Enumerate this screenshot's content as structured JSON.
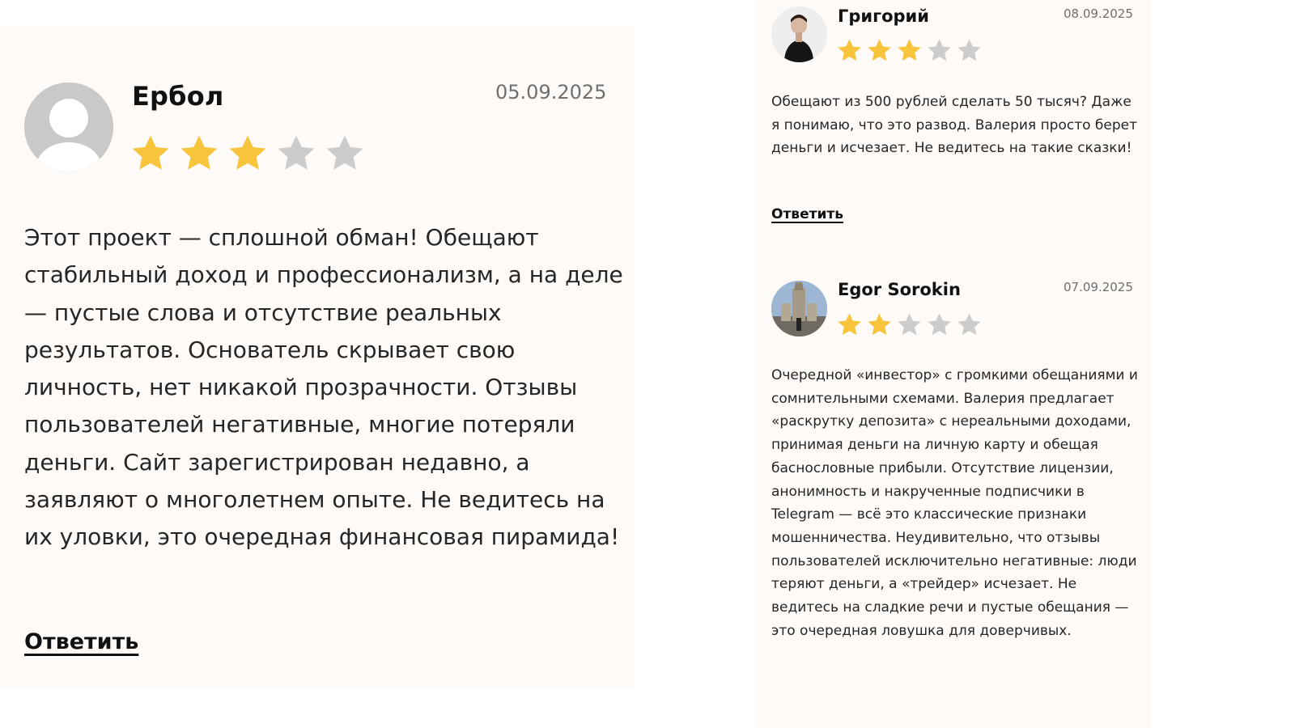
{
  "colors": {
    "star_filled": "#f7c43c",
    "star_empty": "#cccccc",
    "panel_bg": "#fdfaf7",
    "date_text": "#6f6f6f"
  },
  "reviews": [
    {
      "name": "Ербол",
      "date": "05.09.2025",
      "rating": 3,
      "max_rating": 5,
      "avatar": "default-user-avatar",
      "text": "Этот проект — сплошной обман! Обещают стабильный доход и профессионализм, а на деле — пустые слова и отсутствие реальных результатов. Основатель скрывает свою личность, нет никакой прозрачности. Отзывы пользователей негативные, многие потеряли деньги. Сайт зарегистрирован недавно, а заявляют о многолетнем опыте. Не ведитесь на их уловки, это очередная финансовая пирамида!",
      "reply_label": "Ответить"
    },
    {
      "name": "Григорий",
      "date": "08.09.2025",
      "rating": 3,
      "max_rating": 5,
      "avatar": "user-photo-avatar",
      "text": "Обещают из 500 рублей сделать 50 тысяч? Даже я понимаю, что это развод. Валерия просто берет деньги и исчезает. Не ведитесь на такие сказки!",
      "reply_label": "Ответить"
    },
    {
      "name": "Egor Sorokin",
      "date": "07.09.2025",
      "rating": 2,
      "max_rating": 5,
      "avatar": "user-photo-avatar",
      "text": "Очередной «инвестор» с громкими обещаниями и сомнительными схемами. Валерия предлагает «раскрутку депозита» с нереальными доходами, принимая деньги на личную карту и обещая баснословные прибыли. Отсутствие лицензии, анонимность и накрученные подписчики в Telegram — всё это классические признаки мошенничества. Неудивительно, что отзывы пользователей исключительно негативные: люди теряют деньги, а «трейдер» исчезает. Не ведитесь на сладкие речи и пустые обещания — это очередная ловушка для доверчивых."
    }
  ]
}
